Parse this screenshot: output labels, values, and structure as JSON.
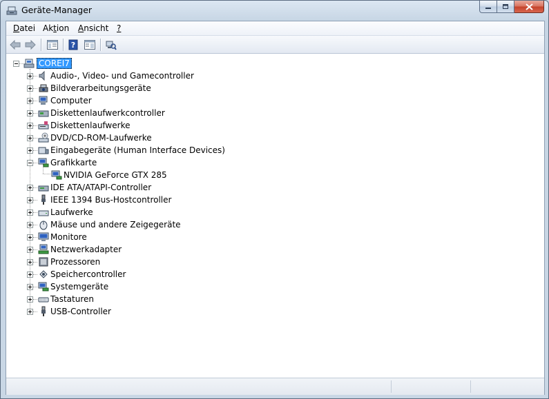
{
  "window": {
    "title": "Geräte-Manager"
  },
  "menu": [
    {
      "before": "",
      "key": "D",
      "after": "atei"
    },
    {
      "before": "Ak",
      "key": "t",
      "after": "ion"
    },
    {
      "before": "",
      "key": "A",
      "after": "nsicht"
    },
    {
      "before": "",
      "key": "?",
      "after": ""
    }
  ],
  "tree": {
    "root": "COREI7",
    "categories": [
      "Audio-, Video- und Gamecontroller",
      "Bildverarbeitungsgeräte",
      "Computer",
      "Diskettenlaufwerkcontroller",
      "Diskettenlaufwerke",
      "DVD/CD-ROM-Laufwerke",
      "Eingabegeräte (Human Interface Devices)",
      "Grafikkarte",
      "IDE ATA/ATAPI-Controller",
      "IEEE 1394 Bus-Hostcontroller",
      "Laufwerke",
      "Mäuse und andere Zeigegeräte",
      "Monitore",
      "Netzwerkadapter",
      "Prozessoren",
      "Speichercontroller",
      "Systemgeräte",
      "Tastaturen",
      "USB-Controller"
    ],
    "grafikkarte_child": "NVIDIA GeForce GTX 285"
  }
}
